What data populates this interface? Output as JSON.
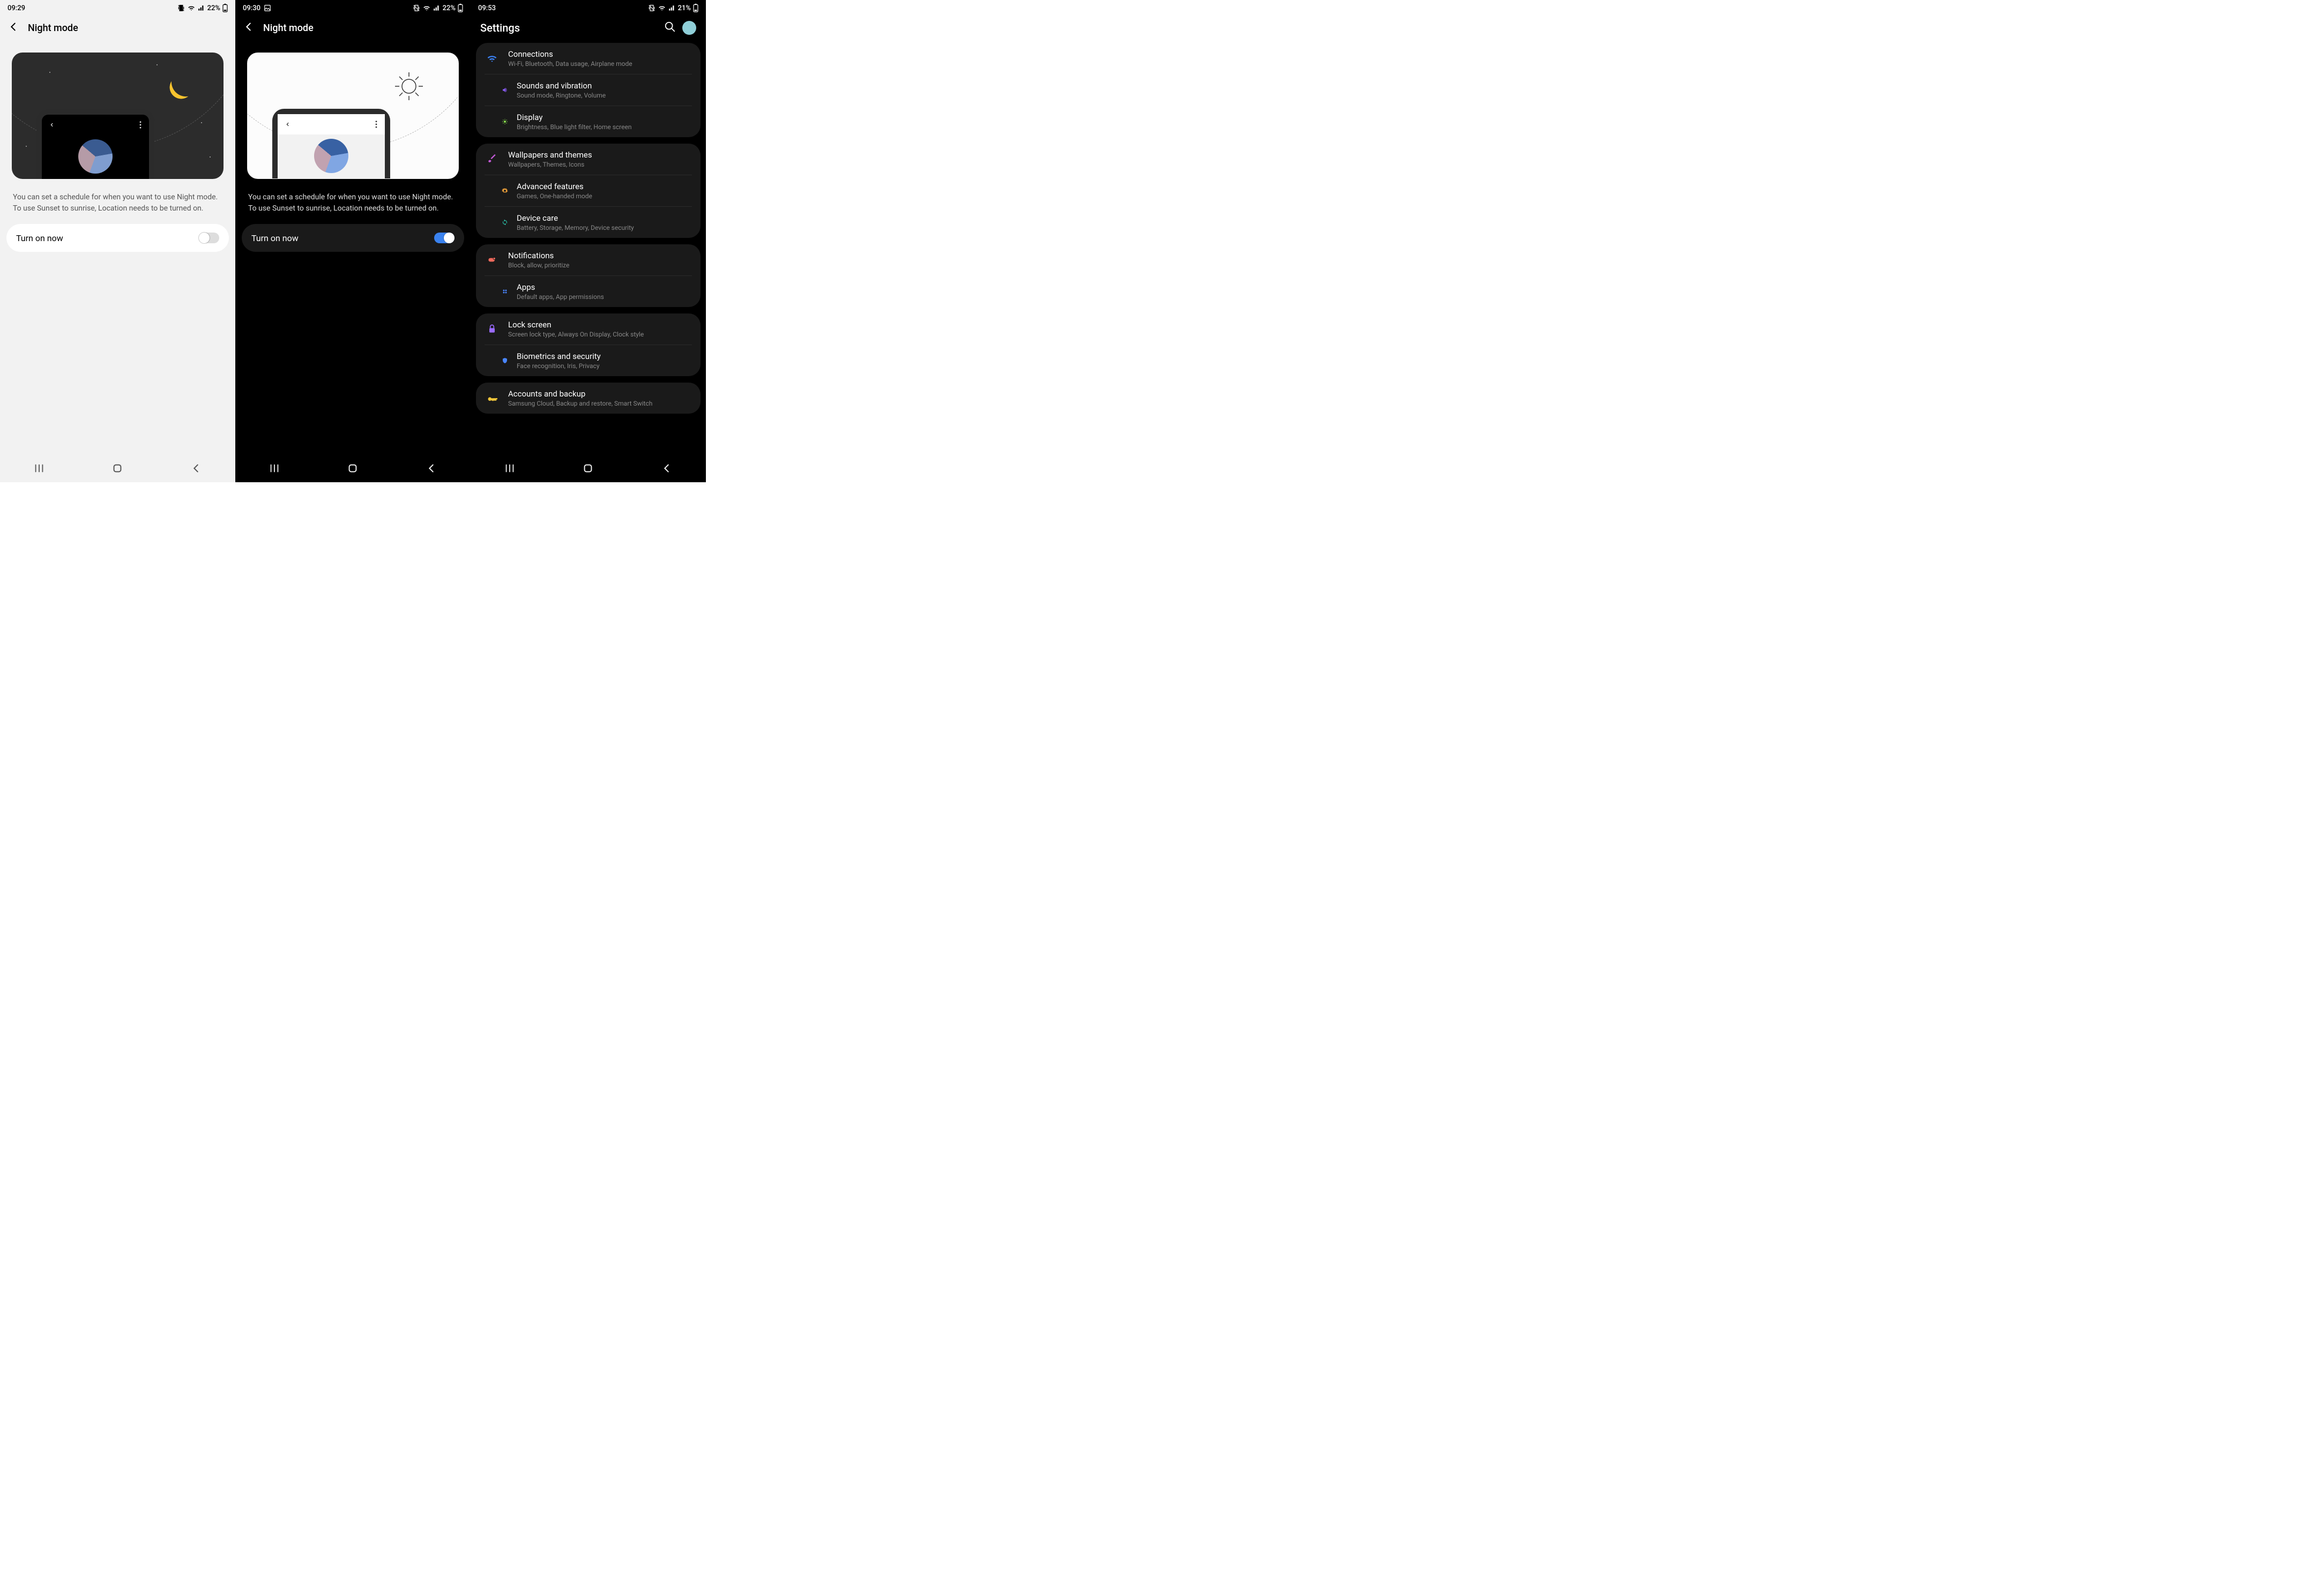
{
  "panel1": {
    "status": {
      "time": "09:29",
      "battery_pct": "22%"
    },
    "header": {
      "title": "Night mode"
    },
    "description": "You can set a schedule for when you want to use Night mode. To use Sunset to sunrise, Location needs to be turned on.",
    "toggle": {
      "label": "Turn on now",
      "on": false
    }
  },
  "panel2": {
    "status": {
      "time": "09:30",
      "battery_pct": "22%"
    },
    "header": {
      "title": "Night mode"
    },
    "description": "You can set a schedule for when you want to use Night mode. To use Sunset to sunrise, Location needs to be turned on.",
    "toggle": {
      "label": "Turn on now",
      "on": true
    }
  },
  "panel3": {
    "status": {
      "time": "09:53",
      "battery_pct": "21%"
    },
    "header": {
      "title": "Settings"
    },
    "groups": [
      [
        {
          "title": "Connections",
          "sub": "Wi-Fi, Bluetooth, Data usage, Airplane mode",
          "icon": "wifi",
          "color": "#3b82f6"
        },
        {
          "title": "Sounds and vibration",
          "sub": "Sound mode, Ringtone, Volume",
          "icon": "sound",
          "color": "#8a5cf6"
        },
        {
          "title": "Display",
          "sub": "Brightness, Blue light filter, Home screen",
          "icon": "bright",
          "color": "#8be04e"
        }
      ],
      [
        {
          "title": "Wallpapers and themes",
          "sub": "Wallpapers, Themes, Icons",
          "icon": "brush",
          "color": "#c45ad8"
        },
        {
          "title": "Advanced features",
          "sub": "Games, One-handed mode",
          "icon": "gear",
          "color": "#f0a23a"
        },
        {
          "title": "Device care",
          "sub": "Battery, Storage, Memory, Device security",
          "icon": "cycle",
          "color": "#2bd0b6"
        }
      ],
      [
        {
          "title": "Notifications",
          "sub": "Block, allow, prioritize",
          "icon": "notif",
          "color": "#f06a5c"
        },
        {
          "title": "Apps",
          "sub": "Default apps, App permissions",
          "icon": "apps",
          "color": "#4a86ff"
        }
      ],
      [
        {
          "title": "Lock screen",
          "sub": "Screen lock type, Always On Display, Clock style",
          "icon": "lock",
          "color": "#9a6bff"
        },
        {
          "title": "Biometrics and security",
          "sub": "Face recognition, Iris, Privacy",
          "icon": "shield",
          "color": "#4a86ff"
        }
      ],
      [
        {
          "title": "Accounts and backup",
          "sub": "Samsung Cloud, Backup and restore, Smart Switch",
          "icon": "key",
          "color": "#f0c53a"
        }
      ]
    ]
  },
  "icons": {
    "mute": "vibrate-mute-icon",
    "wifi": "wifi-icon",
    "signal": "signal-icon",
    "battery": "battery-icon",
    "gallery": "gallery-icon"
  },
  "colors": {
    "toggle_on": "#3a82ef",
    "moon": "#f7c32e"
  }
}
